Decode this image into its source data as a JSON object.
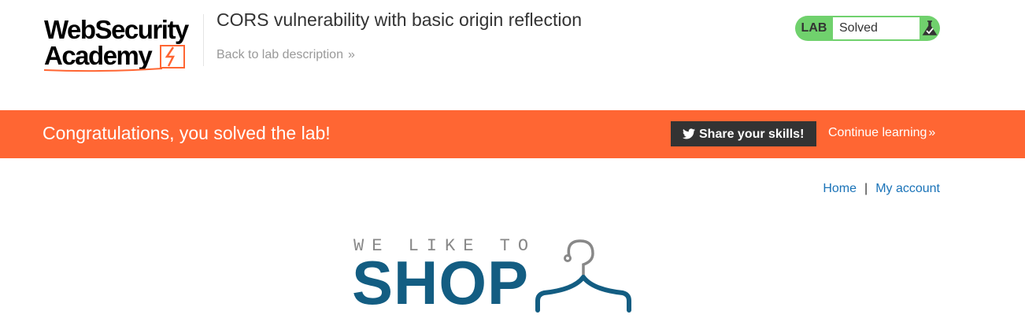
{
  "header": {
    "logo_line1": "WebSecurity",
    "logo_line2": "Academy",
    "lab_title": "CORS vulnerability with basic origin reflection",
    "back_link": "Back to lab description",
    "status": {
      "label": "LAB",
      "value": "Solved"
    }
  },
  "banner": {
    "message": "Congratulations, you solved the lab!",
    "share_button": "Share your skills!",
    "continue_link": "Continue learning"
  },
  "nav": {
    "home": "Home",
    "separator": "|",
    "my_account": "My account"
  },
  "shop_logo": {
    "tagline": "WE LIKE TO",
    "word": "SHOP"
  },
  "colors": {
    "banner": "#ff6633",
    "status_green": "#70d16d",
    "link_blue": "#1a73b8",
    "shop_blue": "#135d82"
  },
  "icons": [
    "lightning-bolt-icon",
    "chevron-right-icon",
    "flask-icon",
    "twitter-icon",
    "hanger-icon"
  ]
}
